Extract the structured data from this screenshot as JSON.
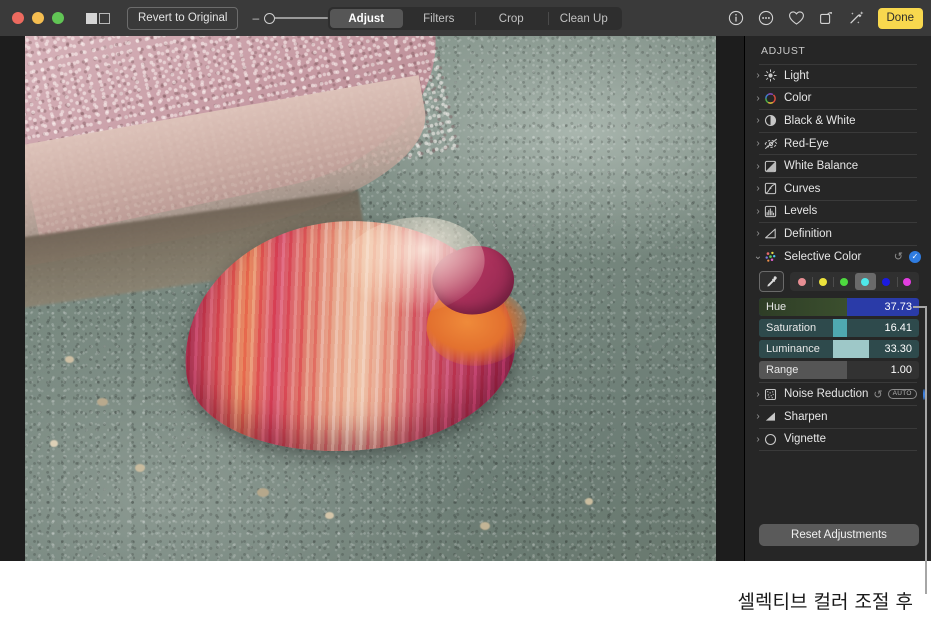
{
  "toolbar": {
    "traffic_lights": [
      "close",
      "minimize",
      "zoom"
    ],
    "split_view_icon": "split-view-icon",
    "revert_label": "Revert to Original",
    "zoom_minus": "–",
    "zoom_plus": "+",
    "tabs": [
      {
        "label": "Adjust",
        "active": true
      },
      {
        "label": "Filters",
        "active": false
      },
      {
        "label": "Crop",
        "active": false
      },
      {
        "label": "Clean Up",
        "active": false
      }
    ],
    "right_icons": [
      "info-icon",
      "more-options-icon",
      "favorite-heart-icon",
      "rotate-icon",
      "auto-enhance-icon"
    ],
    "done_label": "Done"
  },
  "sidebar": {
    "title": "ADJUST",
    "items": [
      {
        "label": "Light",
        "icon": "light-icon",
        "expanded": false
      },
      {
        "label": "Color",
        "icon": "color-wheel-icon",
        "expanded": false
      },
      {
        "label": "Black & White",
        "icon": "black-and-white-icon",
        "expanded": false
      },
      {
        "label": "Red-Eye",
        "icon": "red-eye-icon",
        "expanded": false
      },
      {
        "label": "White Balance",
        "icon": "white-balance-icon",
        "expanded": false
      },
      {
        "label": "Curves",
        "icon": "curves-icon",
        "expanded": false
      },
      {
        "label": "Levels",
        "icon": "levels-icon",
        "expanded": false
      },
      {
        "label": "Definition",
        "icon": "definition-icon",
        "expanded": false
      },
      {
        "label": "Selective Color",
        "icon": "selective-color-icon",
        "expanded": true
      }
    ],
    "selective_color": {
      "revert_icon": "revert-arrow-icon",
      "enabled_checkmark": "✓",
      "eyedropper_icon": "eyedropper-icon",
      "swatches": [
        {
          "name": "red",
          "color": "#e78e93",
          "selected": false
        },
        {
          "name": "yellow",
          "color": "#ece23c",
          "selected": false
        },
        {
          "name": "green",
          "color": "#4ed93f",
          "selected": false
        },
        {
          "name": "cyan",
          "color": "#4ee8ea",
          "selected": true
        },
        {
          "name": "blue",
          "color": "#1b1be0",
          "selected": false
        },
        {
          "name": "magenta",
          "color": "#e23ee0",
          "selected": false
        }
      ],
      "sliders": [
        {
          "name": "Hue",
          "value": "37.73",
          "fill_pct": 55
        },
        {
          "name": "Saturation",
          "value": "16.41",
          "fill_pct": 55
        },
        {
          "name": "Luminance",
          "value": "33.30",
          "fill_pct": 55
        },
        {
          "name": "Range",
          "value": "1.00",
          "fill_pct": 55
        }
      ]
    },
    "lower_items": [
      {
        "label": "Noise Reduction",
        "icon": "noise-reduction-icon",
        "revert_icon": "revert-arrow-icon",
        "auto_label": "AUTO",
        "toggle": "off"
      },
      {
        "label": "Sharpen",
        "icon": "sharpen-icon"
      },
      {
        "label": "Vignette",
        "icon": "vignette-icon"
      }
    ],
    "reset_label": "Reset Adjustments"
  },
  "caption": "셀렉티브 컬러 조절 후",
  "colors": {
    "accent_done": "#f8d84e",
    "toggle_blue": "#2f7ce0",
    "toolbar_bg": "#3a3a3a",
    "sidebar_bg": "#262626"
  }
}
